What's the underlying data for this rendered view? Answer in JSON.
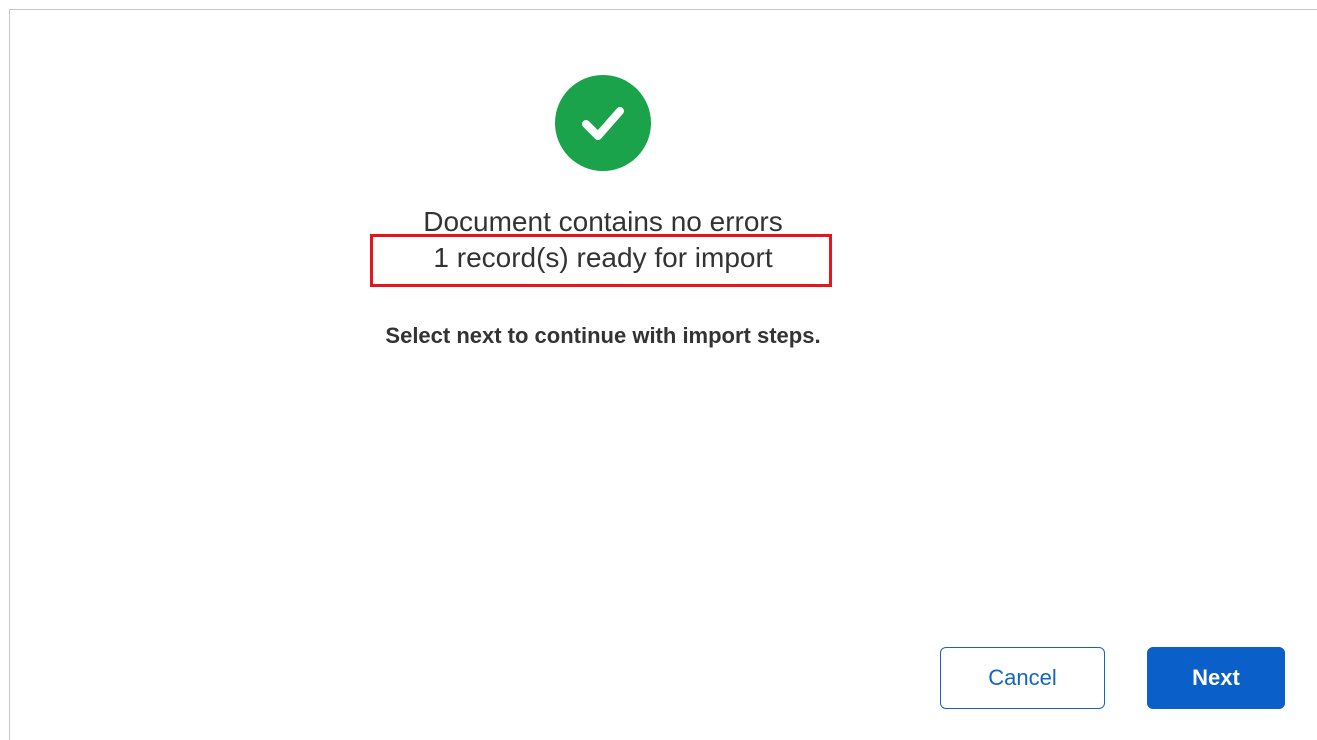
{
  "status": {
    "icon": "check-circle-icon",
    "icon_color": "#1aa34a",
    "title": "Document contains no errors",
    "record_count_text": "1 record(s) ready for import",
    "highlight_color": "#e8141b"
  },
  "instruction": "Select next to continue with import steps.",
  "actions": {
    "cancel_label": "Cancel",
    "next_label": "Next",
    "primary_color": "#0b5fc9"
  }
}
